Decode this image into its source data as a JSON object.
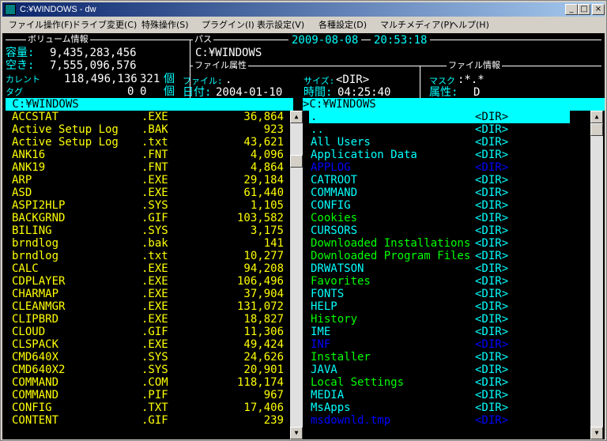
{
  "window": {
    "title": "C:¥WINDOWS - dw",
    "minimize": "_",
    "maximize": "□",
    "close": "×"
  },
  "menu": [
    "ファイル操作(F)",
    "ドライブ変更(C)",
    "特殊操作(S)",
    "プラグイン(I)",
    "表示設定(V)",
    "各種設定(D)",
    "マルチメディア(P)",
    "ヘルプ(H)"
  ],
  "volume": {
    "section_label": "ボリューム情報",
    "capacity_label": "容量:",
    "capacity": "9,435,283,456",
    "free_label": "空き:",
    "free": "7,555,096,576",
    "current_label": "カレント",
    "current_bytes": "118,496,136",
    "current_count": "321",
    "current_unit": "個",
    "tag_label": "タグ",
    "tag_bytes": "0",
    "tag_count": "0",
    "tag_unit": "個"
  },
  "path": {
    "section_label": "パス",
    "value": "C:¥WINDOWS",
    "date": "2009-08-08",
    "time": "20:53:18"
  },
  "fileattr": {
    "section_label": "ファイル属性",
    "file_label": "ファイル:",
    "file_value": ".",
    "date_label": "日付:",
    "date_value": "2004-01-10",
    "size_label": "サイズ:",
    "size_value": "<DIR>",
    "time_label": "時間:",
    "time_value": "04:25:40"
  },
  "fileinfo": {
    "section_label": "ファイル情報",
    "mask_label": "マスク",
    "mask_value": ":*.*",
    "attr_label": "属性:",
    "attr_value": "D"
  },
  "left_panel": {
    "path": " C:¥WINDOWS",
    "files": [
      {
        "name": "ACCSTAT",
        "ext": ".EXE",
        "size": "36,864"
      },
      {
        "name": "Active Setup Log",
        "ext": ".BAK",
        "size": "923"
      },
      {
        "name": "Active Setup Log",
        "ext": ".txt",
        "size": "43,621"
      },
      {
        "name": "ANK16",
        "ext": ".FNT",
        "size": "4,096"
      },
      {
        "name": "ANK19",
        "ext": ".FNT",
        "size": "4,864"
      },
      {
        "name": "ARP",
        "ext": ".EXE",
        "size": "29,184"
      },
      {
        "name": "ASD",
        "ext": ".EXE",
        "size": "61,440"
      },
      {
        "name": "ASPI2HLP",
        "ext": ".SYS",
        "size": "1,105"
      },
      {
        "name": "BACKGRND",
        "ext": ".GIF",
        "size": "103,582"
      },
      {
        "name": "BILING",
        "ext": ".SYS",
        "size": "3,175"
      },
      {
        "name": "brndlog",
        "ext": ".bak",
        "size": "141"
      },
      {
        "name": "brndlog",
        "ext": ".txt",
        "size": "10,277"
      },
      {
        "name": "CALC",
        "ext": ".EXE",
        "size": "94,208"
      },
      {
        "name": "CDPLAYER",
        "ext": ".EXE",
        "size": "106,496"
      },
      {
        "name": "CHARMAP",
        "ext": ".EXE",
        "size": "37,904"
      },
      {
        "name": "CLEANMGR",
        "ext": ".EXE",
        "size": "131,072"
      },
      {
        "name": "CLIPBRD",
        "ext": ".EXE",
        "size": "18,827"
      },
      {
        "name": "CLOUD",
        "ext": ".GIF",
        "size": "11,306"
      },
      {
        "name": "CLSPACK",
        "ext": ".EXE",
        "size": "49,424"
      },
      {
        "name": "CMD640X",
        "ext": ".SYS",
        "size": "24,626"
      },
      {
        "name": "CMD640X2",
        "ext": ".SYS",
        "size": "20,901"
      },
      {
        "name": "COMMAND",
        "ext": ".COM",
        "size": "118,174"
      },
      {
        "name": "COMMAND",
        "ext": ".PIF",
        "size": "967"
      },
      {
        "name": "CONFIG",
        "ext": ".TXT",
        "size": "17,406"
      },
      {
        "name": "CONTENT",
        "ext": ".GIF",
        "size": "239"
      }
    ]
  },
  "right_panel": {
    "path": ">C:¥WINDOWS",
    "entries": [
      {
        "name": ".",
        "type": "<DIR>",
        "color": "#000000"
      },
      {
        "name": "..",
        "type": "<DIR>",
        "color": "#00ffff"
      },
      {
        "name": "All Users",
        "type": "<DIR>",
        "color": "#00ffff"
      },
      {
        "name": "Application Data",
        "type": "<DIR>",
        "color": "#00ffff"
      },
      {
        "name": "APPLOG",
        "type": "<DIR>",
        "color": "#0000ff"
      },
      {
        "name": "CATROOT",
        "type": "<DIR>",
        "color": "#00ffff"
      },
      {
        "name": "COMMAND",
        "type": "<DIR>",
        "color": "#00ffff"
      },
      {
        "name": "CONFIG",
        "type": "<DIR>",
        "color": "#00ffff"
      },
      {
        "name": "Cookies",
        "type": "<DIR>",
        "color": "#00ff00"
      },
      {
        "name": "CURSORS",
        "type": "<DIR>",
        "color": "#00ffff"
      },
      {
        "name": "Downloaded Installations",
        "type": "<DIR>",
        "color": "#00ff00"
      },
      {
        "name": "Downloaded Program Files",
        "type": "<DIR>",
        "color": "#00ff00"
      },
      {
        "name": "DRWATSON",
        "type": "<DIR>",
        "color": "#00ffff"
      },
      {
        "name": "Favorites",
        "type": "<DIR>",
        "color": "#00ff00"
      },
      {
        "name": "FONTS",
        "type": "<DIR>",
        "color": "#00ffff"
      },
      {
        "name": "HELP",
        "type": "<DIR>",
        "color": "#00ffff"
      },
      {
        "name": "History",
        "type": "<DIR>",
        "color": "#00ff00"
      },
      {
        "name": "IME",
        "type": "<DIR>",
        "color": "#00ffff"
      },
      {
        "name": "INF",
        "type": "<DIR>",
        "color": "#0000ff"
      },
      {
        "name": "Installer",
        "type": "<DIR>",
        "color": "#00ff00"
      },
      {
        "name": "JAVA",
        "type": "<DIR>",
        "color": "#00ffff"
      },
      {
        "name": "Local Settings",
        "type": "<DIR>",
        "color": "#00ff00"
      },
      {
        "name": "MEDIA",
        "type": "<DIR>",
        "color": "#00ffff"
      },
      {
        "name": "MsApps",
        "type": "<DIR>",
        "color": "#00ffff"
      },
      {
        "name": "msdownld.tmp",
        "type": "<DIR>",
        "color": "#0000ff"
      }
    ]
  },
  "colors": {
    "file": "#ffff00",
    "dir_default": "#00ffff",
    "highlight": "#00ffff",
    "dir_type": "#00ffff"
  }
}
